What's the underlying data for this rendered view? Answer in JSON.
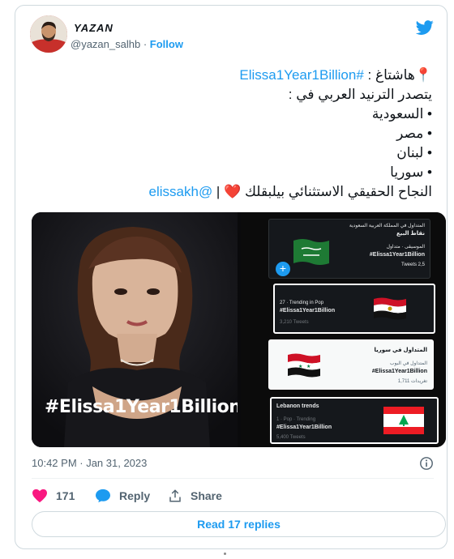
{
  "user": {
    "display_name": "YAZAN",
    "handle": "@yazan_salhb",
    "separator": "·",
    "follow_label": "Follow"
  },
  "tweet": {
    "line1_prefix": "هاشتاغ : ",
    "line1_hashtag": "#Elissa1Year1Billion",
    "line2": "يتصدر الترنيد العربي في :",
    "countries": [
      "• السعودية",
      "• مصر",
      "• لبنان",
      "• سوريا"
    ],
    "line_final_text": "النجاح الحقيقي الاستثنائي بيلبقلك",
    "line_final_separator": " | ",
    "line_final_mention": "@elissakh"
  },
  "media": {
    "photo_hashtag": "#Elissa1Year1Billion",
    "trend_cards": [
      {
        "header": "المتداول في المملكة العربية السعودية",
        "sub": "نقاط البيع",
        "meta": "الموسيقى · متداول",
        "tag": "#Elissa1Year1Billion",
        "count": "Tweets 2,5"
      },
      {
        "header": "27 · Trending in Pop",
        "tag": "#Elissa1Year1Billion",
        "count": "3,210 Tweets"
      },
      {
        "header": "المتداول في سوريا",
        "meta": "المتداول في البوب",
        "tag": "#Elissa1Year1Billion",
        "count": "تغريدات 1,711"
      },
      {
        "header": "Lebanon trends",
        "meta": "1 · Pop · Trending",
        "tag": "#Elissa1Year1Billion",
        "count": "5,400 Tweets"
      }
    ]
  },
  "meta": {
    "timestamp": "10:42 PM · Jan 31, 2023"
  },
  "actions": {
    "like_count": "171",
    "reply_label": "Reply",
    "share_label": "Share"
  },
  "footer": {
    "read_replies_label": "Read 17 replies"
  },
  "colors": {
    "accent": "#1d9bf0",
    "like": "#f91880",
    "muted": "#536471",
    "border": "#cfd9de"
  },
  "icons": [
    "twitter-bird-icon",
    "pin-icon",
    "heart-icon",
    "reply-bubble-icon",
    "share-icon",
    "info-icon",
    "plus-icon"
  ]
}
